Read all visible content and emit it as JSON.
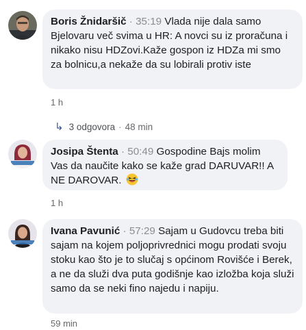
{
  "comments": [
    {
      "author": "Boris Žnidaršič",
      "separator": "·",
      "timestamp": "35:19",
      "text": "Vlada nije dala samo Bjelovaru več svima u HR: A novci su iz proračuna i nikako nisu HDZovi.Kaže gospon iz HDZa mi smo za bolnicu,a nekaže da su lobirali protiv iste",
      "age": "1 h",
      "replies": {
        "count_label": "3 odgovora",
        "separator": "·",
        "age": "48 min"
      }
    },
    {
      "author": "Josipa Štenta",
      "separator": "·",
      "timestamp": "50:49",
      "text": "Gospodine Bajs molim Vas da naučite kako se kaže grad DARUVAR!! A NE DAROVAR.",
      "emoji": "laughing-face-icon",
      "age": "1 h"
    },
    {
      "author": "Ivana Pavunić",
      "separator": "·",
      "timestamp": "57:29",
      "text": "Sajam u Gudovcu treba biti sajam na kojem poljoprivrednici mogu prodati svoju stoku kao što je to slučaj s općinom Rovišće i Berek, a ne da služi dva puta godišnje kao izložba koja služi samo da se neki fino najedu i napiju.",
      "age": "59 min"
    }
  ],
  "colors": {
    "bubble": "#f0f2f5",
    "meta_text": "#65676b",
    "reply_arrow": "#385898"
  }
}
